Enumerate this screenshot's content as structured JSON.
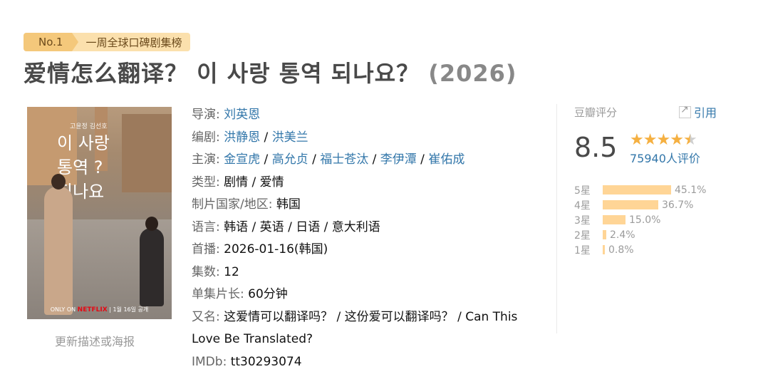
{
  "badge": {
    "rank": "No.1",
    "list": "一周全球口碑剧集榜"
  },
  "title": {
    "main": "爱情怎么翻译？ 이 사랑 통역 되나요？",
    "year": "(2026)"
  },
  "poster": {
    "title_lines": [
      "이 사랑",
      "통역 ?",
      "되나요"
    ],
    "small_top": "고윤정  김선호",
    "only_on": "ONLY ON",
    "netflix": "NETFLIX",
    "date": "1월 16일 공개"
  },
  "update_link": "更新描述或海报",
  "info": {
    "director": {
      "label": "导演",
      "names": [
        "刘英恩"
      ]
    },
    "writer": {
      "label": "编剧",
      "names": [
        "洪静恩",
        "洪美兰"
      ]
    },
    "cast": {
      "label": "主演",
      "names": [
        "金宣虎",
        "高允贞",
        "福士苍汰",
        "李伊潭",
        "崔佑成"
      ]
    },
    "genre": {
      "label": "类型",
      "value": "剧情 / 爱情"
    },
    "country": {
      "label": "制片国家/地区",
      "value": "韩国"
    },
    "language": {
      "label": "语言",
      "value": "韩语 / 英语 / 日语 / 意大利语"
    },
    "premiere": {
      "label": "首播",
      "value": "2026-01-16(韩国)"
    },
    "episodes": {
      "label": "集数",
      "value": "12"
    },
    "runtime": {
      "label": "单集片长",
      "value": "60分钟"
    },
    "aka": {
      "label": "又名",
      "value": "这爱情可以翻译吗？ / 这份爱可以翻译吗？ / Can This Love Be Translated?"
    },
    "imdb": {
      "label": "IMDb",
      "value": "tt30293074"
    }
  },
  "rating": {
    "label": "豆瓣评分",
    "cite": "引用",
    "score": "8.5",
    "stars": 4.5,
    "votes": "75940人评价",
    "distribution": [
      {
        "label": "5星",
        "pct": "45.1%",
        "value": 45.1
      },
      {
        "label": "4星",
        "pct": "36.7%",
        "value": 36.7
      },
      {
        "label": "3星",
        "pct": "15.0%",
        "value": 15.0
      },
      {
        "label": "2星",
        "pct": "2.4%",
        "value": 2.4
      },
      {
        "label": "1星",
        "pct": "0.8%",
        "value": 0.8
      }
    ],
    "colors": {
      "star": "#f5b041",
      "bar": "#ffd596",
      "link": "#3377aa"
    }
  }
}
